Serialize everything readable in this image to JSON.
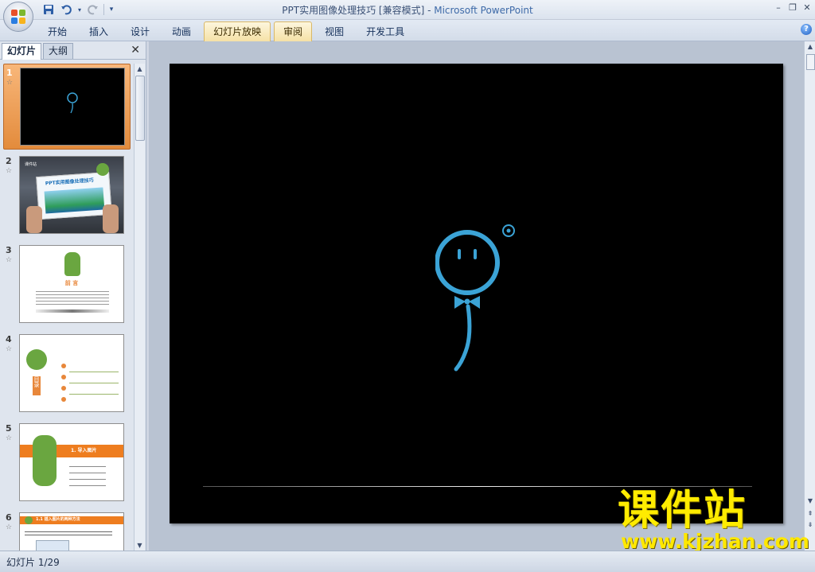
{
  "window": {
    "title_doc": "PPT实用图像处理技巧 [兼容模式]",
    "title_sep": " - ",
    "title_app": "Microsoft PowerPoint",
    "minimize": "–",
    "restore": "❐",
    "close": "✕"
  },
  "qat": {
    "save_icon": "save-icon",
    "undo_icon": "undo-icon",
    "redo_icon": "redo-icon",
    "customize": "▾"
  },
  "ribbon": {
    "tabs": [
      {
        "label": "开始"
      },
      {
        "label": "插入"
      },
      {
        "label": "设计"
      },
      {
        "label": "动画"
      },
      {
        "label": "幻灯片放映"
      },
      {
        "label": "审阅"
      },
      {
        "label": "视图"
      },
      {
        "label": "开发工具"
      }
    ],
    "help": "?"
  },
  "panel": {
    "tab_slides": "幻灯片",
    "tab_outline": "大纲",
    "close": "✕",
    "slides": [
      {
        "num": "1"
      },
      {
        "num": "2",
        "title": "PPT实用图像处理技巧",
        "corner": "课件站"
      },
      {
        "num": "3",
        "heading": "前 言"
      },
      {
        "num": "4",
        "side": "目录"
      },
      {
        "num": "5",
        "title": "1. 导入图片"
      },
      {
        "num": "6",
        "title": "1.1 插入图片的两种方法"
      }
    ]
  },
  "status": {
    "slide_info": "幻灯片 1/29"
  },
  "watermark": {
    "brand": "课件站",
    "url": "www.kjzhan.com"
  },
  "colors": {
    "accent_orange": "#e8873a",
    "balloon_blue": "#3ba3d6",
    "slide_bg": "#000000"
  }
}
